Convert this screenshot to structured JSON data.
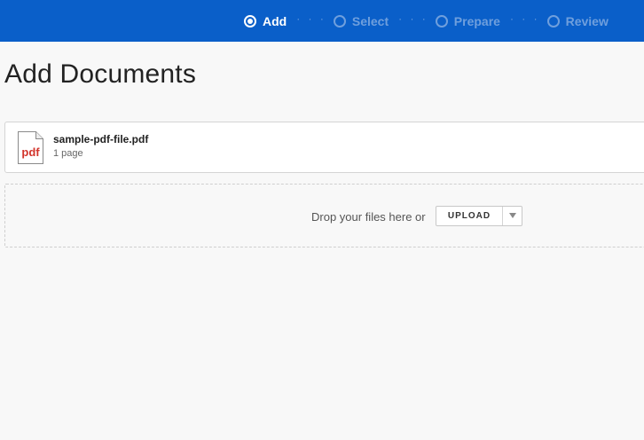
{
  "stepper": {
    "steps": [
      {
        "label": "Add",
        "active": true
      },
      {
        "label": "Select",
        "active": false
      },
      {
        "label": "Prepare",
        "active": false
      },
      {
        "label": "Review",
        "active": false
      }
    ],
    "separator": "· · ·"
  },
  "page": {
    "title": "Add Documents"
  },
  "file": {
    "icon_label": "pdf",
    "name": "sample-pdf-file.pdf",
    "pages": "1 page"
  },
  "dropzone": {
    "text": "Drop your files here or",
    "upload_label": "UPLOAD"
  },
  "colors": {
    "topbar": "#0a5fc9",
    "step_inactive": "#6f9fdd",
    "pdf_red": "#d2342b"
  },
  "icons": {
    "step_active": "radio-filled-icon",
    "step_inactive": "radio-empty-icon",
    "file": "pdf-file-icon",
    "dropdown": "caret-down-icon"
  }
}
